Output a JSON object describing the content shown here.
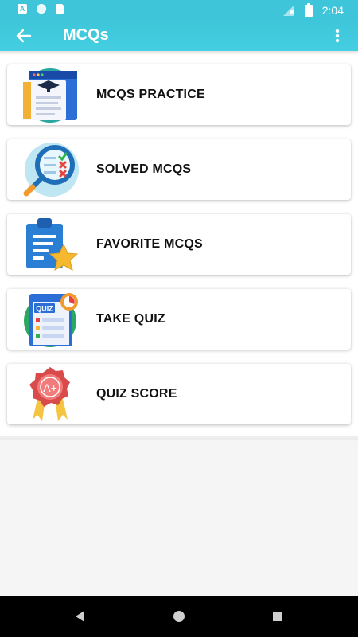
{
  "status_bar": {
    "time": "2:04",
    "left_badge": "A"
  },
  "app_bar": {
    "title": "MCQs",
    "accent_color": "#3ec5d9"
  },
  "menu": {
    "items": [
      {
        "label": "MCQS PRACTICE",
        "icon": "mcqs-practice-icon"
      },
      {
        "label": "SOLVED MCQS",
        "icon": "solved-mcqs-icon"
      },
      {
        "label": "FAVORITE MCQS",
        "icon": "favorite-mcqs-icon"
      },
      {
        "label": "TAKE QUIZ",
        "icon": "take-quiz-icon"
      },
      {
        "label": "QUIZ SCORE",
        "icon": "quiz-score-icon"
      }
    ]
  },
  "quiz_icon_text": "QUIZ",
  "score_icon_text": "A+"
}
